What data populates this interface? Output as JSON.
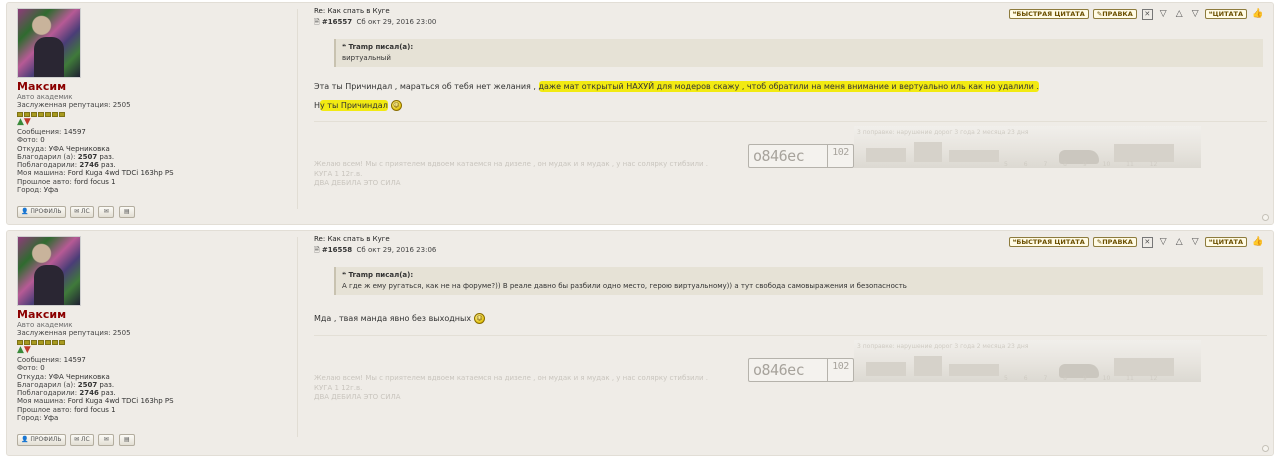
{
  "posts": [
    {
      "user": {
        "name": "Максим",
        "rank": "Авто академик",
        "reputation_label": "Заслуженная репутация:",
        "reputation_value": "2505",
        "stats": [
          {
            "key": "Сообщения:",
            "value": "14597"
          },
          {
            "key": "Фото:",
            "value": "0"
          },
          {
            "key": "Откуда:",
            "value": "УФА Черниковка"
          },
          {
            "key": "Благодарил (а):",
            "value": "2507",
            "suffix": "раз."
          },
          {
            "key": "Поблагодарили:",
            "value": "2746",
            "suffix": "раз."
          },
          {
            "key": "Моя машина:",
            "value": "Ford Kuga 4wd TDCi 163hp PS"
          },
          {
            "key": "Прошлое авто:",
            "value": "ford focus 1"
          },
          {
            "key": "Город:",
            "value": "Уфа"
          }
        ],
        "buttons": {
          "profile": "ПРОФИЛЬ",
          "pm": "ЛС"
        }
      },
      "title": "Re: Как спать в Куге",
      "number": "#16557",
      "date": "Сб окт 29, 2016 23:00",
      "actions": {
        "quick_quote": "БЫСТРАЯ ЦИТАТА",
        "edit": "ПРАВКА",
        "quote": "ЦИТАТА"
      },
      "quote": {
        "author": "Tramp писал(а):",
        "text": "виртуальный"
      },
      "body": {
        "plain": "Эта ты Причиндал , мараться об тебя нет желания ,",
        "highlight": "даже мат открытый НАХУЙ для модеров скажу , чтоб обратили на меня внимание и вертуально иль как но удалили .",
        "line2_prefix": "Н",
        "line2_highlight": "у ты Причиндал"
      },
      "signature": {
        "line1": "Желаю всем! Мы с приятелем вдвоем катаемся на дизеле , он мудак и я мудак , у нас солярку стибзили .",
        "line2": "КУГА 1 12г.в.",
        "line3": "ДВА ДЕБИЛА ЭТО СИЛА",
        "plate": "о846ес",
        "plate_region": "102",
        "banner_text": "3 поправке: нарушение дорог 3 года 2 месяца 23 дня",
        "banner_ticks": "5 6 7 8 9 10 11 12"
      }
    },
    {
      "user": {
        "name": "Максим",
        "rank": "Авто академик",
        "reputation_label": "Заслуженная репутация:",
        "reputation_value": "2505",
        "stats": [
          {
            "key": "Сообщения:",
            "value": "14597"
          },
          {
            "key": "Фото:",
            "value": "0"
          },
          {
            "key": "Откуда:",
            "value": "УФА Черниковка"
          },
          {
            "key": "Благодарил (а):",
            "value": "2507",
            "suffix": "раз."
          },
          {
            "key": "Поблагодарили:",
            "value": "2746",
            "suffix": "раз."
          },
          {
            "key": "Моя машина:",
            "value": "Ford Kuga 4wd TDCi 163hp PS"
          },
          {
            "key": "Прошлое авто:",
            "value": "ford focus 1"
          },
          {
            "key": "Город:",
            "value": "Уфа"
          }
        ],
        "buttons": {
          "profile": "ПРОФИЛЬ",
          "pm": "ЛС"
        }
      },
      "title": "Re: Как спать в Куге",
      "number": "#16558",
      "date": "Сб окт 29, 2016 23:06",
      "actions": {
        "quick_quote": "БЫСТРАЯ ЦИТАТА",
        "edit": "ПРАВКА",
        "quote": "ЦИТАТА"
      },
      "quote": {
        "author": "Tramp писал(а):",
        "text": "А где ж ему ругаться, как не на форуме?)) В реале давно бы разбили одно место, герою виртуальному)) а тут свобода самовыражения и безопасность"
      },
      "body": {
        "plain": "Мда , твая манда явно без выходных"
      },
      "signature": {
        "line1": "Желаю всем! Мы с приятелем вдвоем катаемся на дизеле , он мудак и я мудак , у нас солярку стибзили .",
        "line2": "КУГА 1 12г.в.",
        "line3": "ДВА ДЕБИЛА ЭТО СИЛА",
        "plate": "о846ес",
        "plate_region": "102",
        "banner_text": "3 поправке: нарушение дорог 3 года 2 месяца 23 дня",
        "banner_ticks": "5 6 7 8 9 10 11 12"
      }
    }
  ]
}
